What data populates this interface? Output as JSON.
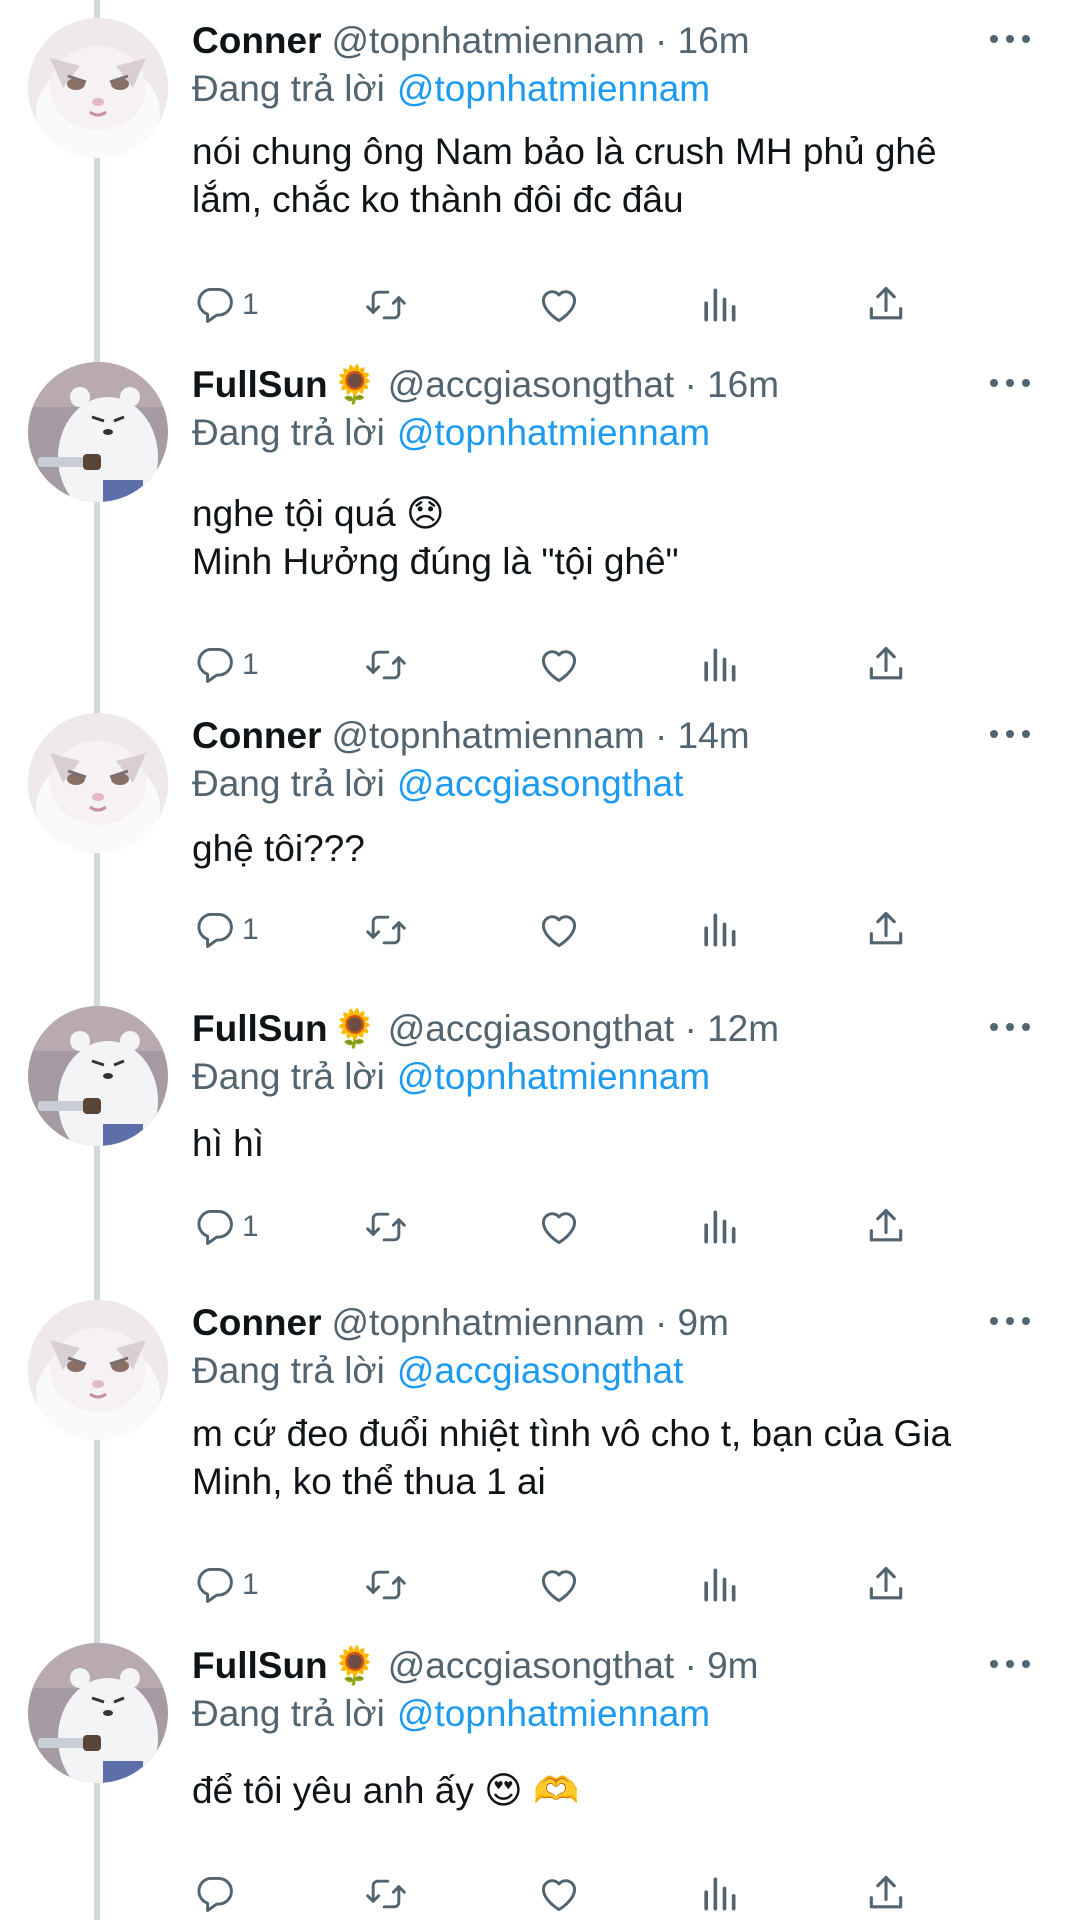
{
  "thread": {
    "reply_prefix": "Đang trả lời",
    "tweets": [
      {
        "author": "Conner",
        "emoji": "",
        "handle": "@topnhatmiennam · 16m",
        "reply_to": "@topnhatmiennam",
        "text": "nói chung ông Nam bảo là crush MH phủ ghê\nlắm, chắc ko thành đôi đc đâu",
        "reply_count": "1",
        "avatar": "cat"
      },
      {
        "author": "FullSun",
        "emoji": "🌻",
        "handle": "@accgiasongthat · 16m",
        "reply_to": "@topnhatmiennam",
        "text": "nghe tội quá 😞\nMinh Hưởng đúng là \"tội ghê\"",
        "reply_count": "1",
        "avatar": "bear"
      },
      {
        "author": "Conner",
        "emoji": "",
        "handle": "@topnhatmiennam · 14m",
        "reply_to": "@accgiasongthat",
        "text": "ghệ tôi???",
        "reply_count": "1",
        "avatar": "cat"
      },
      {
        "author": "FullSun",
        "emoji": "🌻",
        "handle": "@accgiasongthat · 12m",
        "reply_to": "@topnhatmiennam",
        "text": "hì hì",
        "reply_count": "1",
        "avatar": "bear"
      },
      {
        "author": "Conner",
        "emoji": "",
        "handle": "@topnhatmiennam · 9m",
        "reply_to": "@accgiasongthat",
        "text": "m cứ đeo đuổi nhiệt tình vô cho t, bạn của Gia\nMinh, ko thể thua 1 ai",
        "reply_count": "1",
        "avatar": "cat"
      },
      {
        "author": "FullSun",
        "emoji": "🌻",
        "handle": "@accgiasongthat · 9m",
        "reply_to": "@topnhatmiennam",
        "text": "để tôi yêu anh ấy 😍 🫶",
        "reply_count": "",
        "avatar": "bear"
      }
    ]
  },
  "icons": {
    "reply": "reply-icon",
    "retweet": "retweet-icon",
    "like": "heart-icon",
    "views": "analytics-icon",
    "share": "share-icon",
    "more": "more-icon"
  },
  "colors": {
    "link": "#1d9bf0",
    "secondary": "#536471",
    "thread_line": "#cfd9de"
  }
}
